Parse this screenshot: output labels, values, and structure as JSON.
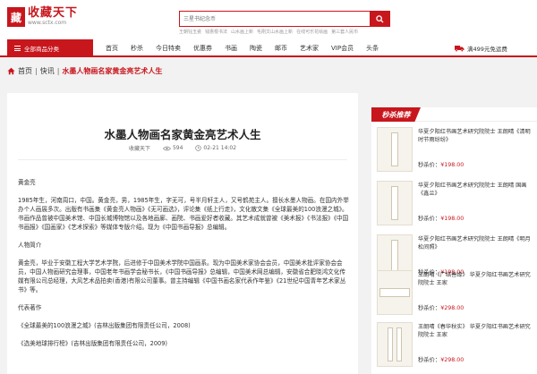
{
  "brand": {
    "logo_char": "藏",
    "name": "收藏天下",
    "url": "www.sctx.com"
  },
  "search": {
    "placeholder": "三星书纪念币",
    "hot": [
      "王朝钰玉瓷",
      "钱惠根书法",
      "山水画上新",
      "毛刚文山水画上新",
      "在线可乐花绘画",
      "第三套人民币"
    ]
  },
  "nav": {
    "category_label": "全部商品分类",
    "items": [
      "首页",
      "秒杀",
      "今日特卖",
      "优惠券",
      "书画",
      "陶瓷",
      "邮币",
      "艺术家",
      "VIP会员",
      "头条"
    ],
    "promo": "满499元免运费"
  },
  "breadcrumb": {
    "home": "首页",
    "section": "快讯",
    "current": "水墨人物画名家黄金亮艺术人生",
    "sep": "|"
  },
  "article": {
    "title": "水墨人物画名家黄金亮艺术人生",
    "source": "收藏天下",
    "views": "594",
    "date": "02-21 14:02",
    "paragraphs": [
      "黄金亮",
      "1985年生，河南周口，中国。黄金亮，男，1985年生，字无可，号半月轩主人，又号鹤苑主人。擅长水墨人物画。在国内外举办个人画展多次。出版有书画集《黄金亮人物画》《无可画选》，评论集《纸上行走》，文化散文集《全球最美的100浪漫之城》。书画作品曾被中国美术馆、中国长城博物馆以及各地画廊、画院、书画爱好者收藏。其艺术成就曾被《美术报》《书法报》《中国书画报》《国画家》《艺术探索》等媒体专版介绍。现为《中国书画导报》总编辑。",
      "人物简介",
      "黄金亮，毕业于安徽工程大学艺术学院，后进修于中国美术学院中国画系。现为中国美术家协会会员，中国美术批评家协会会员，中国人物画研究会理事，中国老年书画学会秘书长，《中国书画导报》总编辑，中国美术网总编辑，安徽省合肥晓鸿文化传媒有限公司总经理，大风艺术品拍卖(香港)有限公司董事。曾主持编辑《中国书画名家代表作年鉴》《21世纪中国青年艺术家丛书》等。",
      "代表著作",
      "《全球最美的100浪漫之城》(吉林出版集团有限责任公司，2008)",
      "《选美地球排行榜》(吉林出版集团有限责任公司，2009)"
    ]
  },
  "sidebar": {
    "title": "秒杀推荐",
    "price_label": "秒杀价：",
    "products": [
      {
        "name": "华夏夕阳红书画艺术研究院院士 王朗晴《清明时节雨纷纷》",
        "price": "¥198.00",
        "img": "tall"
      },
      {
        "name": "华夏夕阳红书画艺术研究院院士 王朗晴 国画《鑫兰》",
        "price": "¥198.00",
        "img": "tall"
      },
      {
        "name": "华夏夕阳红书画艺术研究院院士 王朗晴《明月松间照》",
        "price": "¥198.00",
        "img": "tall"
      },
      {
        "name": "王朗晴《广结善缘》 华夏夕阳红书画艺术研究院院士 王家",
        "price": "¥298.00",
        "img": "wide"
      },
      {
        "name": "王朗晴《春华秋实》 华夏夕阳红书画艺术研究院院士 王家",
        "price": "¥298.00",
        "img": "pair"
      }
    ]
  }
}
